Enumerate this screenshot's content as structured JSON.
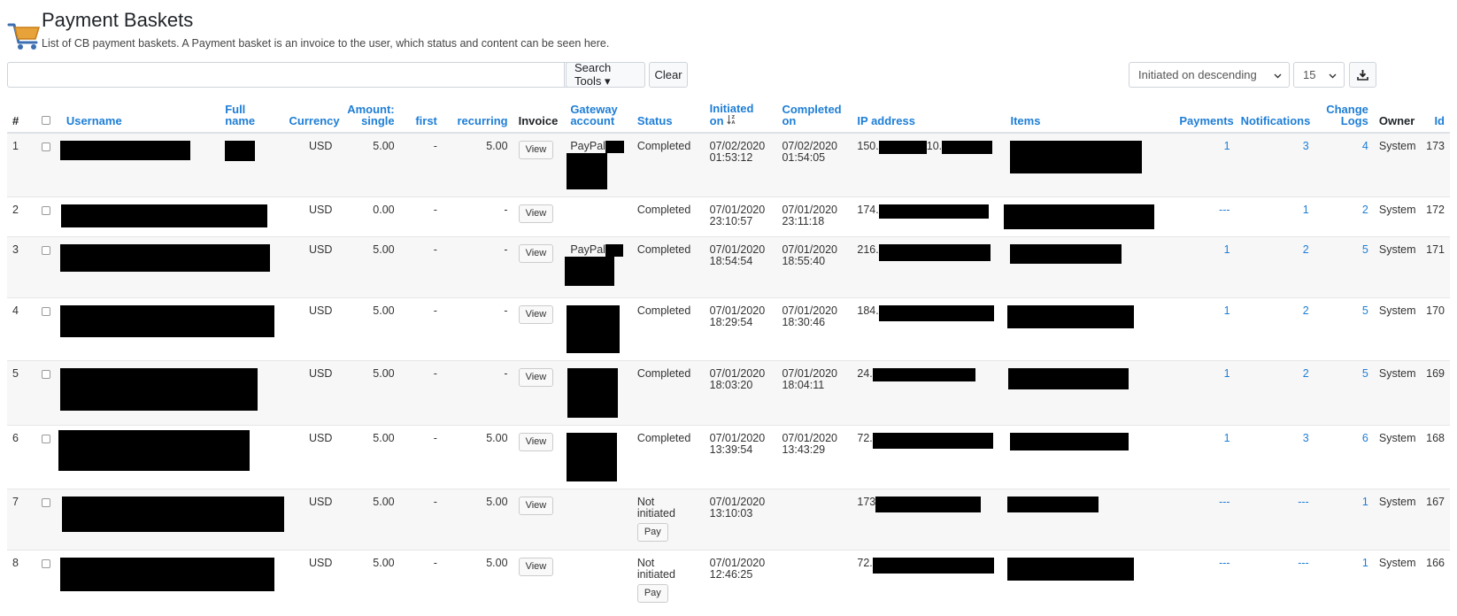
{
  "page": {
    "title": "Payment Baskets",
    "description": "List of CB payment baskets. A Payment basket is an invoice to the user, which status and content can be seen here."
  },
  "toolbar": {
    "search_value": "",
    "search_tools_label": "Search Tools ▾",
    "clear_label": "Clear",
    "sort_selected": "Initiated on descending",
    "limit_selected": "15"
  },
  "columns": {
    "num": "#",
    "username": "Username",
    "fullname_1": "Full",
    "fullname_2": "name",
    "currency": "Currency",
    "amount_1": "Amount:",
    "amount_2": "single",
    "first": "first",
    "recurring": "recurring",
    "invoice": "Invoice",
    "gateway_1": "Gateway",
    "gateway_2": "account",
    "status": "Status",
    "initiated_1": "Initiated",
    "initiated_2": "on",
    "completed_1": "Completed",
    "completed_2": "on",
    "ip": "IP address",
    "items": "Items",
    "payments": "Payments",
    "notifications": "Notifications",
    "changelogs_1": "Change",
    "changelogs_2": "Logs",
    "owner": "Owner",
    "id": "Id"
  },
  "rows": [
    {
      "num": "1",
      "currency": "USD",
      "amount": "5.00",
      "first": "-",
      "recurring": "5.00",
      "invoice": "View",
      "gateway": "PayPal",
      "status": "Completed",
      "init_date": "07/02/2020",
      "init_time": "01:53:12",
      "comp_date": "07/02/2020",
      "comp_time": "01:54:05",
      "ip_prefix": "150.",
      "ip_mid": "10.",
      "payments": "1",
      "notifications": "3",
      "changelogs": "4",
      "owner": "System",
      "id": "173"
    },
    {
      "num": "2",
      "currency": "USD",
      "amount": "0.00",
      "first": "-",
      "recurring": "-",
      "invoice": "View",
      "gateway": "",
      "status": "Completed",
      "init_date": "07/01/2020",
      "init_time": "23:10:57",
      "comp_date": "07/01/2020",
      "comp_time": "23:11:18",
      "ip_prefix": "174.",
      "payments": "---",
      "notifications": "1",
      "changelogs": "2",
      "owner": "System",
      "id": "172"
    },
    {
      "num": "3",
      "currency": "USD",
      "amount": "5.00",
      "first": "-",
      "recurring": "-",
      "invoice": "View",
      "gateway": "PayPal",
      "status": "Completed",
      "init_date": "07/01/2020",
      "init_time": "18:54:54",
      "comp_date": "07/01/2020",
      "comp_time": "18:55:40",
      "ip_prefix": "216.",
      "payments": "1",
      "notifications": "2",
      "changelogs": "5",
      "owner": "System",
      "id": "171"
    },
    {
      "num": "4",
      "currency": "USD",
      "amount": "5.00",
      "first": "-",
      "recurring": "-",
      "invoice": "View",
      "gateway": "",
      "status": "Completed",
      "init_date": "07/01/2020",
      "init_time": "18:29:54",
      "comp_date": "07/01/2020",
      "comp_time": "18:30:46",
      "ip_prefix": "184.",
      "payments": "1",
      "notifications": "2",
      "changelogs": "5",
      "owner": "System",
      "id": "170"
    },
    {
      "num": "5",
      "currency": "USD",
      "amount": "5.00",
      "first": "-",
      "recurring": "-",
      "invoice": "View",
      "gateway": "",
      "status": "Completed",
      "init_date": "07/01/2020",
      "init_time": "18:03:20",
      "comp_date": "07/01/2020",
      "comp_time": "18:04:11",
      "ip_prefix": "24.",
      "payments": "1",
      "notifications": "2",
      "changelogs": "5",
      "owner": "System",
      "id": "169"
    },
    {
      "num": "6",
      "currency": "USD",
      "amount": "5.00",
      "first": "-",
      "recurring": "5.00",
      "invoice": "View",
      "gateway": "",
      "status": "Completed",
      "init_date": "07/01/2020",
      "init_time": "13:39:54",
      "comp_date": "07/01/2020",
      "comp_time": "13:43:29",
      "ip_prefix": "72.",
      "payments": "1",
      "notifications": "3",
      "changelogs": "6",
      "owner": "System",
      "id": "168"
    },
    {
      "num": "7",
      "currency": "USD",
      "amount": "5.00",
      "first": "-",
      "recurring": "5.00",
      "invoice": "View",
      "gateway": "",
      "status_1": "Not",
      "status_2": "initiated",
      "pay": "Pay",
      "init_date": "07/01/2020",
      "init_time": "13:10:03",
      "ip_prefix": "173",
      "payments": "---",
      "notifications": "---",
      "changelogs": "1",
      "owner": "System",
      "id": "167"
    },
    {
      "num": "8",
      "currency": "USD",
      "amount": "5.00",
      "first": "-",
      "recurring": "5.00",
      "invoice": "View",
      "gateway": "",
      "status_1": "Not",
      "status_2": "initiated",
      "pay": "Pay",
      "init_date": "07/01/2020",
      "init_time": "12:46:25",
      "ip_prefix": "72.",
      "payments": "---",
      "notifications": "---",
      "changelogs": "1",
      "owner": "System",
      "id": "166"
    }
  ]
}
